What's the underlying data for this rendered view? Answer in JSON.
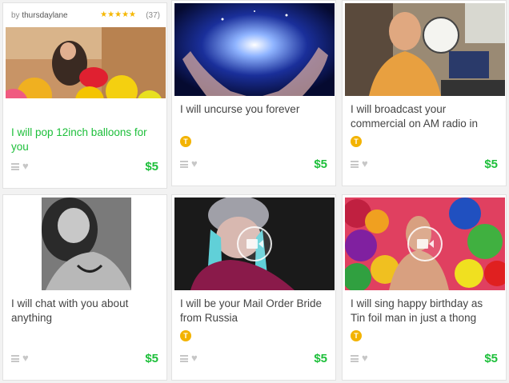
{
  "gigs": [
    {
      "seller": "thursdaylane",
      "by_prefix": "by",
      "rating_stars": "★★★★★",
      "rating_count": "(37)",
      "title": "I will pop 12inch balloons for you",
      "price": "$5",
      "badge": ""
    },
    {
      "title": "I will uncurse you forever",
      "price": "$5",
      "badge": "T"
    },
    {
      "title": "I will broadcast your commercial on AM radio in",
      "price": "$5",
      "badge": "T"
    },
    {
      "title": "I will chat with you about anything",
      "price": "$5",
      "badge": ""
    },
    {
      "title": "I will be your Mail Order Bride from Russia",
      "price": "$5",
      "badge": "T"
    },
    {
      "title": "I will sing happy birthday as Tin foil man in just a thong",
      "price": "$5",
      "badge": "T"
    }
  ],
  "colors": {
    "price_green": "#1dbf3a",
    "badge_gold": "#f3b300",
    "star_gold": "#f5b700"
  },
  "icons": {
    "list": "menu-icon",
    "favorite": "heart-icon",
    "video": "video-camera-icon"
  }
}
